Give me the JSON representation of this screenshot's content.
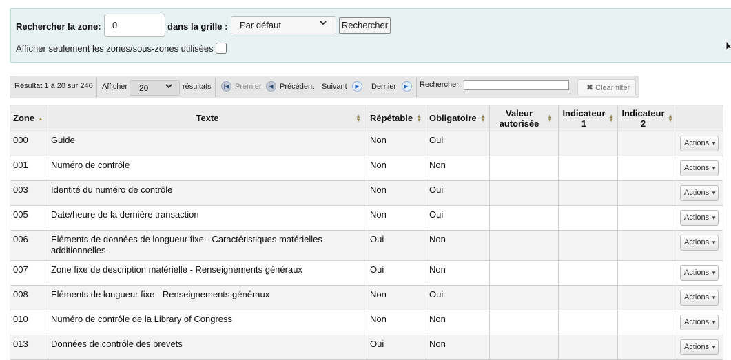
{
  "search": {
    "zone_label": "Rechercher la zone:",
    "zone_value": "0",
    "grid_label": "dans la grille :",
    "grid_selected": "Par défaut",
    "search_button": "Rechercher",
    "used_only_label": "Afficher seulement les zones/sous-zones utilisées",
    "used_only_checked": false
  },
  "pager": {
    "result_info": "Résultat 1 à 20 sur 240",
    "show_label": "Afficher",
    "per_page": "20",
    "results_label": "résultats",
    "first": "Premier",
    "previous": "Précédent",
    "next": "Suivant",
    "last": "Dernier",
    "filter_label": "Rechercher :",
    "filter_value": "",
    "clear_filter": "Clear filter"
  },
  "table": {
    "headers": {
      "zone": "Zone",
      "text": "Texte",
      "repeatable": "Répétable",
      "mandatory": "Obligatoire",
      "authorized_1": "Valeur",
      "authorized_2": "autorisée",
      "ind1_1": "Indicateur",
      "ind1_2": "1",
      "ind2_1": "Indicateur",
      "ind2_2": "2"
    },
    "actions_label": "Actions",
    "rows": [
      {
        "zone": "000",
        "text": "Guide",
        "repeatable": "Non",
        "mandatory": "Oui"
      },
      {
        "zone": "001",
        "text": "Numéro de contrôle",
        "repeatable": "Non",
        "mandatory": "Non"
      },
      {
        "zone": "003",
        "text": "Identité du numéro de contrôle",
        "repeatable": "Non",
        "mandatory": "Oui"
      },
      {
        "zone": "005",
        "text": "Date/heure de la dernière transaction",
        "repeatable": "Non",
        "mandatory": "Oui"
      },
      {
        "zone": "006",
        "text": "Éléments de données de longueur fixe - Caractéristiques matérielles additionnelles",
        "repeatable": "Oui",
        "mandatory": "Non"
      },
      {
        "zone": "007",
        "text": "Zone fixe de description matérielle - Renseignements généraux",
        "repeatable": "Oui",
        "mandatory": "Non"
      },
      {
        "zone": "008",
        "text": "Éléments de longueur fixe - Renseignements généraux",
        "repeatable": "Non",
        "mandatory": "Oui"
      },
      {
        "zone": "010",
        "text": "Numéro de contrôle de la Library of Congress",
        "repeatable": "Non",
        "mandatory": "Non"
      },
      {
        "zone": "013",
        "text": "Données de contrôle des brevets",
        "repeatable": "Oui",
        "mandatory": "Non"
      }
    ]
  }
}
